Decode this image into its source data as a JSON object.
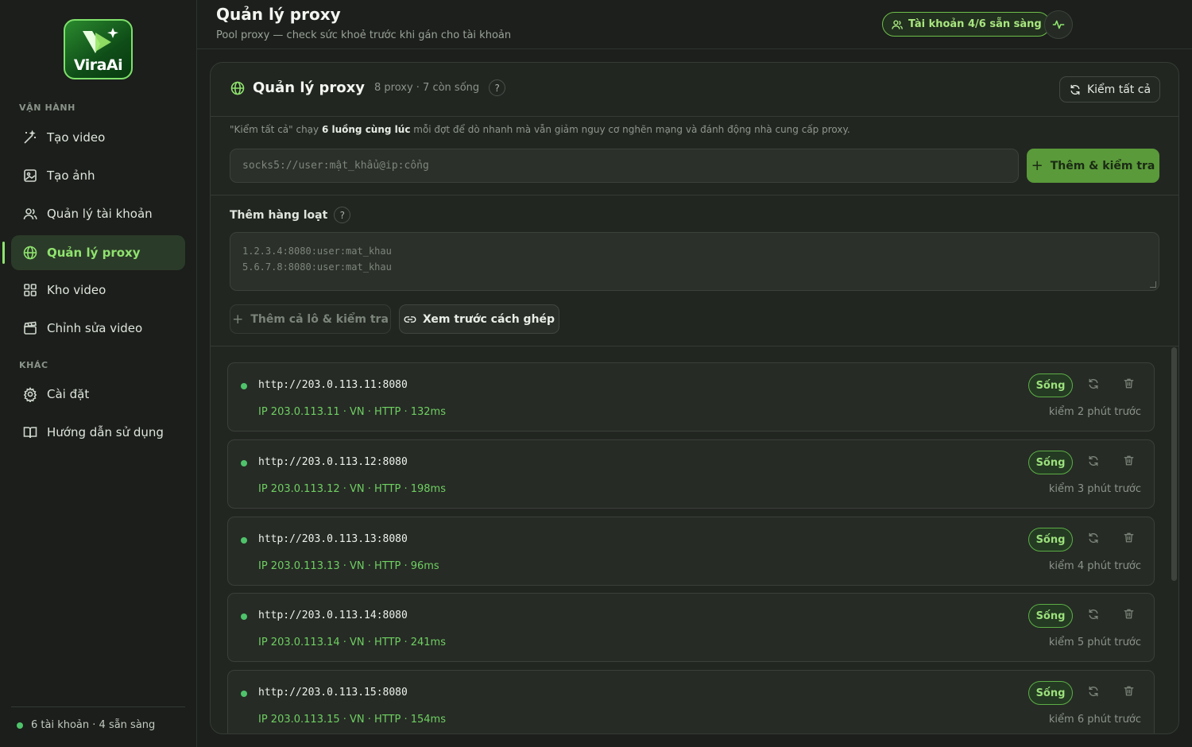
{
  "brand": {
    "name": "ViraAi"
  },
  "sidebar": {
    "section_ops": "VẬN HÀNH",
    "section_other": "KHÁC",
    "items": [
      {
        "label": "Tạo video",
        "icon": "magic-wand-icon"
      },
      {
        "label": "Tạo ảnh",
        "icon": "image-icon"
      },
      {
        "label": "Quản lý tài khoản",
        "icon": "users-icon"
      },
      {
        "label": "Quản lý proxy",
        "icon": "globe-icon",
        "active": true
      },
      {
        "label": "Kho video",
        "icon": "grid-icon"
      },
      {
        "label": "Chỉnh sửa video",
        "icon": "clapperboard-icon"
      },
      {
        "label": "Cài đặt",
        "icon": "gear-icon"
      },
      {
        "label": "Hướng dẫn sử dụng",
        "icon": "book-icon"
      }
    ],
    "footer": "6 tài khoản · 4 sẵn sàng"
  },
  "header": {
    "title": "Quản lý proxy",
    "subtitle": "Pool proxy — check sức khoẻ trước khi gán cho tài khoản",
    "accounts_pill": "Tài khoản 4/6 sẵn sàng"
  },
  "card": {
    "title": "Quản lý proxy",
    "meta": "8 proxy · 7 còn sống",
    "help": "?",
    "check_all_label": "Kiểm tất cả",
    "note_prefix": "\"Kiểm tất cả\" chạy ",
    "note_bold": "6 luồng cùng lúc",
    "note_suffix": " mỗi đợt để dò nhanh mà vẫn giảm nguy cơ nghẽn mạng và đánh động nhà cung cấp proxy.",
    "input_placeholder": "socks5://user:mật_khẩu@ip:cổng",
    "add_label": "Thêm & kiểm tra",
    "batch_label": "Thêm hàng loạt",
    "batch_placeholder_line1": "1.2.3.4:8080:user:mat_khau",
    "batch_placeholder_line2": "5.6.7.8:8080:user:mat_khau",
    "batch_add_label": "Thêm cả lô & kiểm tra",
    "preview_label": "Xem trước cách ghép"
  },
  "proxies": [
    {
      "url": "http://203.0.113.11:8080",
      "info": "IP 203.0.113.11 · VN · HTTP · 132ms",
      "status": "Sống",
      "checked": "kiểm 2 phút trước"
    },
    {
      "url": "http://203.0.113.12:8080",
      "info": "IP 203.0.113.12 · VN · HTTP · 198ms",
      "status": "Sống",
      "checked": "kiểm 3 phút trước"
    },
    {
      "url": "http://203.0.113.13:8080",
      "info": "IP 203.0.113.13 · VN · HTTP · 96ms",
      "status": "Sống",
      "checked": "kiểm 4 phút trước"
    },
    {
      "url": "http://203.0.113.14:8080",
      "info": "IP 203.0.113.14 · VN · HTTP · 241ms",
      "status": "Sống",
      "checked": "kiểm 5 phút trước"
    },
    {
      "url": "http://203.0.113.15:8080",
      "info": "IP 203.0.113.15 · VN · HTTP · 154ms",
      "status": "Sống",
      "checked": "kiểm 6 phút trước"
    }
  ],
  "colors": {
    "accent": "#8fe36e",
    "button_green": "#5a9a3a",
    "live": "#4fc36b",
    "background": "#1c1f1c"
  }
}
